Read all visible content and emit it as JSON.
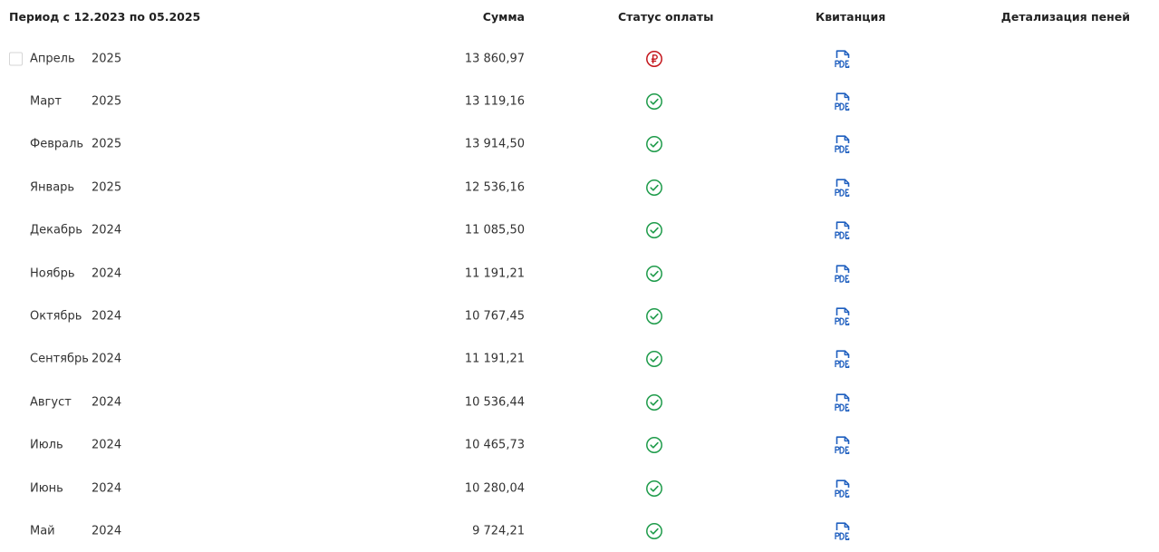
{
  "header": {
    "period": "Период с 12.2023 по 05.2025",
    "sum": "Сумма",
    "status": "Статус оплаты",
    "receipt": "Квитанция",
    "penalty": "Детализация пеней"
  },
  "colors": {
    "paid": "#1e9b4a",
    "unpaid": "#c4161c",
    "pdf": "#1f5fbf"
  },
  "rows": [
    {
      "month": "Апрель",
      "year": "2025",
      "amount": "13 860,97",
      "status": "unpaid",
      "status_icon": "ruble-circle-icon",
      "receipt_icon": "pdf-icon"
    },
    {
      "month": "Март",
      "year": "2025",
      "amount": "13 119,16",
      "status": "paid",
      "status_icon": "check-circle-icon",
      "receipt_icon": "pdf-icon"
    },
    {
      "month": "Февраль",
      "year": "2025",
      "amount": "13 914,50",
      "status": "paid",
      "status_icon": "check-circle-icon",
      "receipt_icon": "pdf-icon"
    },
    {
      "month": "Январь",
      "year": "2025",
      "amount": "12 536,16",
      "status": "paid",
      "status_icon": "check-circle-icon",
      "receipt_icon": "pdf-icon"
    },
    {
      "month": "Декабрь",
      "year": "2024",
      "amount": "11 085,50",
      "status": "paid",
      "status_icon": "check-circle-icon",
      "receipt_icon": "pdf-icon"
    },
    {
      "month": "Ноябрь",
      "year": "2024",
      "amount": "11 191,21",
      "status": "paid",
      "status_icon": "check-circle-icon",
      "receipt_icon": "pdf-icon"
    },
    {
      "month": "Октябрь",
      "year": "2024",
      "amount": "10 767,45",
      "status": "paid",
      "status_icon": "check-circle-icon",
      "receipt_icon": "pdf-icon"
    },
    {
      "month": "Сентябрь",
      "year": "2024",
      "amount": "11 191,21",
      "status": "paid",
      "status_icon": "check-circle-icon",
      "receipt_icon": "pdf-icon"
    },
    {
      "month": "Август",
      "year": "2024",
      "amount": "10 536,44",
      "status": "paid",
      "status_icon": "check-circle-icon",
      "receipt_icon": "pdf-icon"
    },
    {
      "month": "Июль",
      "year": "2024",
      "amount": "10 465,73",
      "status": "paid",
      "status_icon": "check-circle-icon",
      "receipt_icon": "pdf-icon"
    },
    {
      "month": "Июнь",
      "year": "2024",
      "amount": "10 280,04",
      "status": "paid",
      "status_icon": "check-circle-icon",
      "receipt_icon": "pdf-icon"
    },
    {
      "month": "Май",
      "year": "2024",
      "amount": "9 724,21",
      "status": "paid",
      "status_icon": "check-circle-icon",
      "receipt_icon": "pdf-icon"
    }
  ]
}
